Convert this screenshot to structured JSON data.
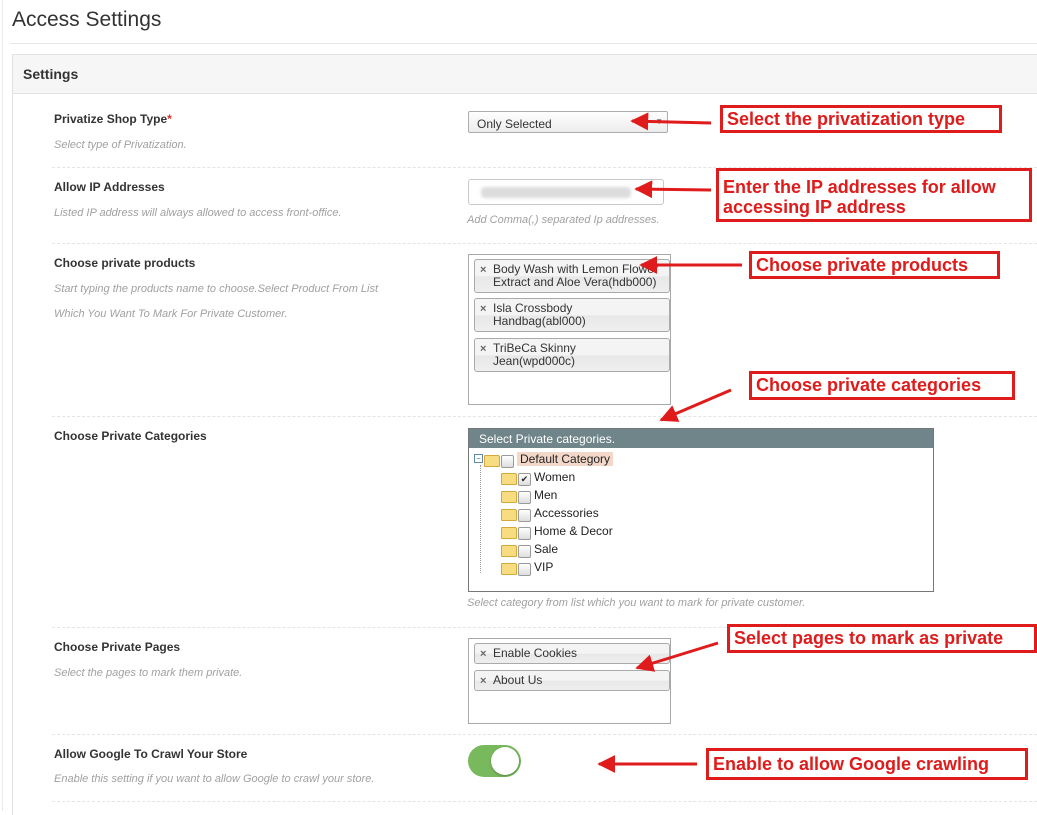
{
  "page": {
    "title": "Access Settings"
  },
  "panel": {
    "title": "Settings"
  },
  "privatize": {
    "label": "Privatize Shop Type",
    "required_mark": "*",
    "hint": "Select type of Privatization.",
    "value": "Only Selected"
  },
  "ip": {
    "label": "Allow IP Addresses",
    "hint": "Listed IP address will always allowed to access front-office.",
    "note": "Add Comma(,) separated Ip addresses."
  },
  "products": {
    "label": "Choose private products",
    "hint1": "Start typing the products name to choose.Select Product From List",
    "hint2": "Which You Want To Mark For Private Customer.",
    "items": [
      {
        "line1": "Body Wash with Lemon Flower",
        "line2": "Extract and Aloe Vera(hdb000)"
      },
      {
        "line1": "Isla Crossbody",
        "line2": "Handbag(abl000)"
      },
      {
        "line1": "TriBeCa Skinny",
        "line2": "Jean(wpd000c)"
      }
    ],
    "remove_glyph": "×"
  },
  "categories": {
    "label": "Choose Private Categories",
    "header": "Select Private categories.",
    "root": "Default Category",
    "children": [
      {
        "name": "Women",
        "checked": true
      },
      {
        "name": "Men",
        "checked": false
      },
      {
        "name": "Accessories",
        "checked": false
      },
      {
        "name": "Home & Decor",
        "checked": false
      },
      {
        "name": "Sale",
        "checked": false
      },
      {
        "name": "VIP",
        "checked": false
      }
    ],
    "note": "Select category from list which you want to mark for private customer."
  },
  "pages": {
    "label": "Choose Private Pages",
    "hint": "Select the pages to mark them private.",
    "items": [
      "Enable Cookies",
      "About Us"
    ]
  },
  "crawl": {
    "label": "Allow Google To Crawl Your Store",
    "hint": "Enable this setting if you want to allow Google to crawl your store.",
    "enabled": true
  },
  "callouts": {
    "type": "Select the privatization type",
    "ip_line1": "Enter the IP addresses for allow",
    "ip_line2": "accessing IP address",
    "products": "Choose private products",
    "categories": "Choose private categories",
    "pages": "Select pages to mark as private",
    "crawl": "Enable to allow Google crawling"
  },
  "colors": {
    "callout_red": "#e01b1b",
    "toggle_on": "#79b95d",
    "tree_header": "#6f8589",
    "required": "#e02b27"
  },
  "icons": {
    "check": "✔",
    "minus": "−"
  }
}
